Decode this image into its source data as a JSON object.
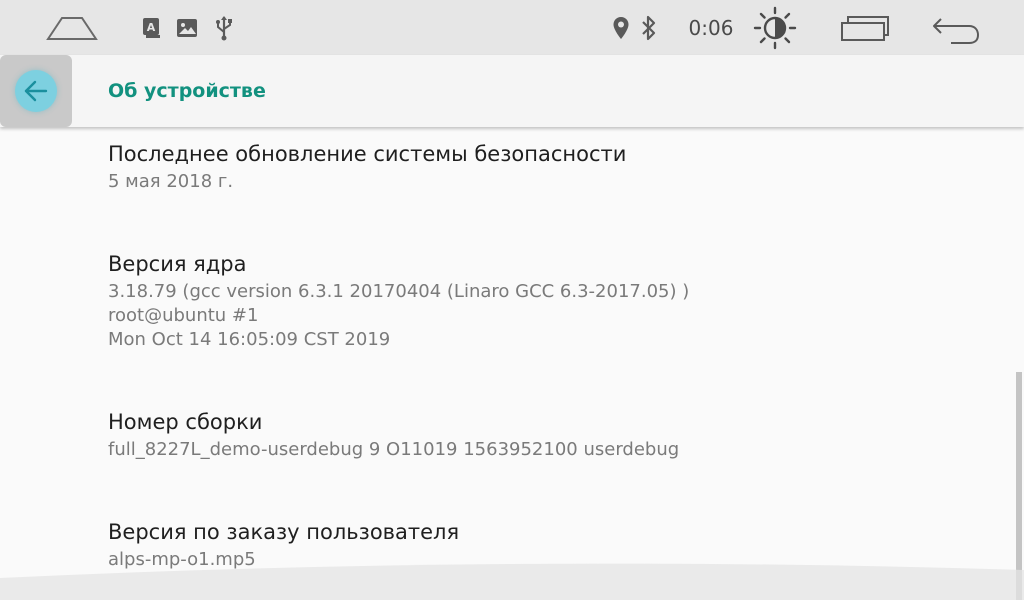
{
  "status_bar": {
    "icons": [
      "home-icon",
      "keyboard-icon",
      "image-icon",
      "usb-icon",
      "location-icon",
      "bluetooth-icon",
      "brightness-icon",
      "recents-icon",
      "back-icon"
    ],
    "clock": "0:06",
    "keyboard_glyph": "A"
  },
  "app_bar": {
    "title": "Об устройстве",
    "back_icon": "arrow-left-icon",
    "accent_color": "#12917f"
  },
  "items": [
    {
      "title": "Последнее обновление системы безопасности",
      "summary": [
        "5 мая 2018 г."
      ]
    },
    {
      "title": "Версия ядра",
      "summary": [
        "3.18.79 (gcc version 6.3.1 20170404 (Linaro GCC 6.3-2017.05) )",
        "root@ubuntu #1",
        "Mon Oct 14 16:05:09 CST 2019"
      ]
    },
    {
      "title": "Номер сборки",
      "summary": [
        "full_8227L_demo-userdebug 9 O11019 1563952100 userdebug"
      ]
    },
    {
      "title": "Версия по заказу пользователя",
      "summary": [
        "alps-mp-o1.mp5"
      ]
    }
  ]
}
